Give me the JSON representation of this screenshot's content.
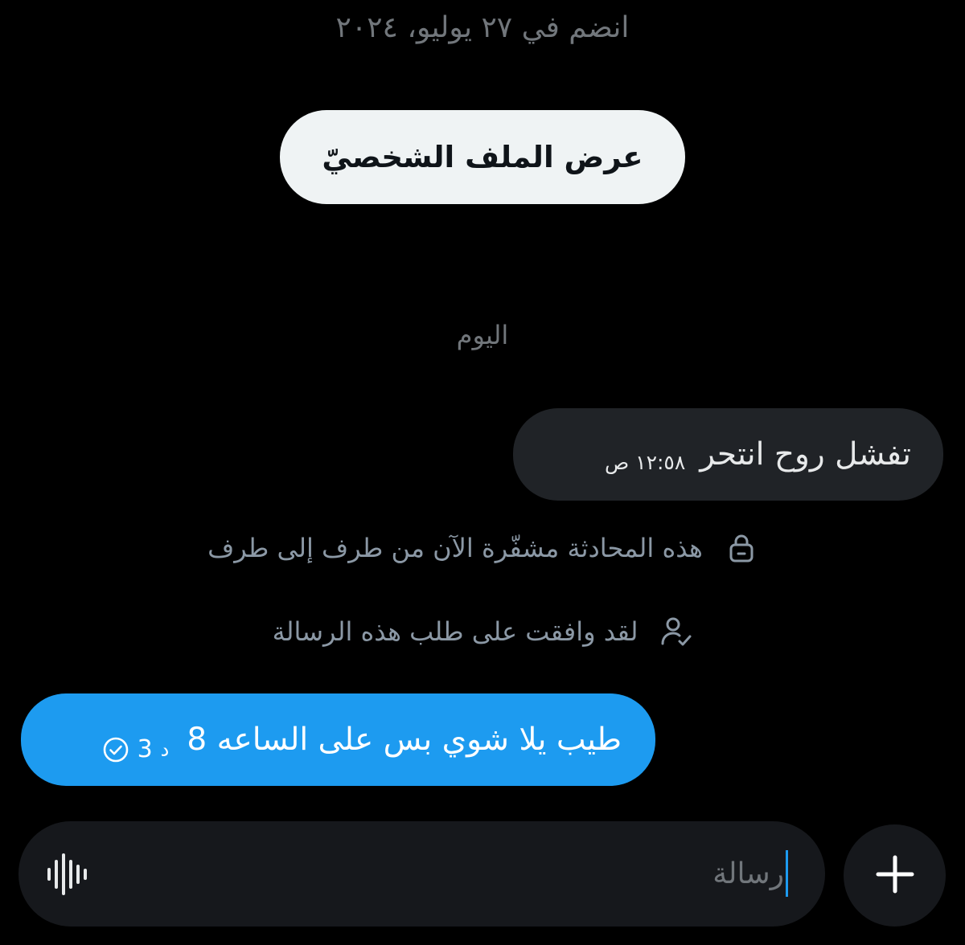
{
  "header": {
    "joined_text": "انضم في ٢٧ يوليو، ٢٠٢٤",
    "view_profile_label": "عرض الملف الشخصيّ"
  },
  "conversation": {
    "day_separator": "اليوم",
    "incoming_message": {
      "text": "تفشل روح انتحر",
      "time": "١٢:٥٨ ص"
    },
    "system_notices": [
      {
        "text": "هذه المحادثة مشفّرة الآن من طرف إلى طرف",
        "icon": "lock-icon"
      },
      {
        "text": "لقد وافقت على طلب هذه الرسالة",
        "icon": "user-check-icon"
      }
    ],
    "outgoing_message": {
      "text": "طيب يلا شوي بس على الساعه 8",
      "age_number": "3",
      "age_unit": "د",
      "status_icon": "sent-check-icon"
    }
  },
  "composer": {
    "placeholder": "رسالة",
    "voice_icon": "voice-waveform-icon",
    "add_icon": "plus-icon"
  },
  "colors": {
    "background": "#000000",
    "accent": "#1d9bf0",
    "incoming_bubble": "#202327",
    "secondary_text": "#71767b"
  }
}
